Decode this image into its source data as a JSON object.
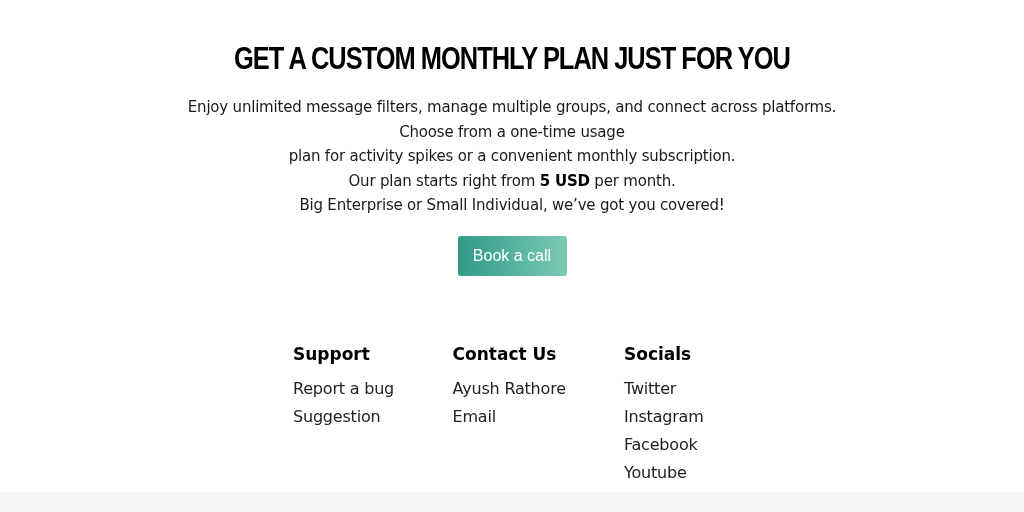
{
  "heading": "GET A CUSTOM MONTHLY PLAN JUST FOR YOU",
  "description_lines": [
    "Enjoy unlimited message filters, manage multiple groups, and connect across platforms.",
    "Choose from a one-time usage",
    "plan for activity spikes or a convenient monthly subscription.",
    "Our plan starts right from **5 USD** per month.",
    "Big Enterprise or Small Individual, we’ve got you covered!"
  ],
  "cta_button": {
    "label": "Book a call"
  },
  "footer": {
    "columns": [
      {
        "title": "Support",
        "links": [
          "Report a bug",
          "Suggestion"
        ]
      },
      {
        "title": "Contact Us",
        "links": [
          "Ayush Rathore",
          "Email"
        ]
      },
      {
        "title": "Socials",
        "links": [
          "Twitter",
          "Instagram",
          "Facebook",
          "Youtube"
        ]
      }
    ]
  }
}
